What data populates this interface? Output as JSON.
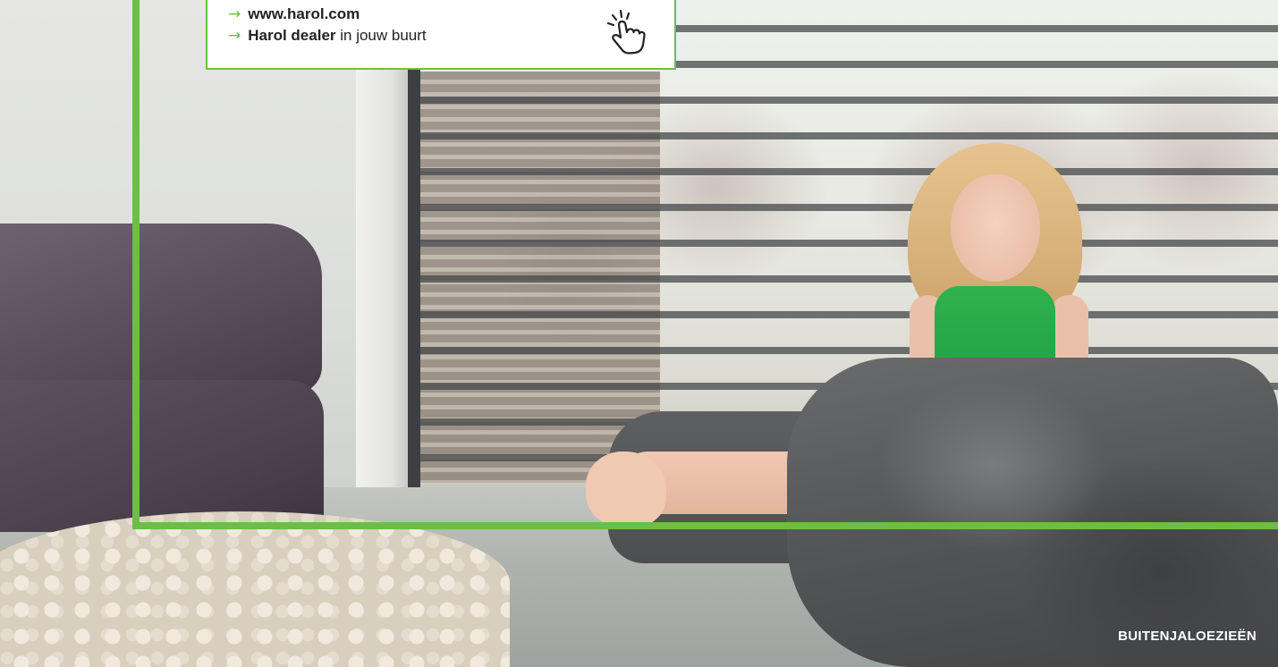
{
  "info_box": {
    "link_1": {
      "arrow": "→",
      "bold_text": "www.harol.com",
      "text": ""
    },
    "link_2": {
      "arrow": "→",
      "bold_text": "Harol dealer",
      "text": " in jouw buurt"
    },
    "icon": "tap-hand-icon"
  },
  "category_label": "BUITENJALOEZIEËN",
  "colors": {
    "accent_green": "#6abf45",
    "text_dark": "#222222",
    "label_white": "#ffffff"
  }
}
